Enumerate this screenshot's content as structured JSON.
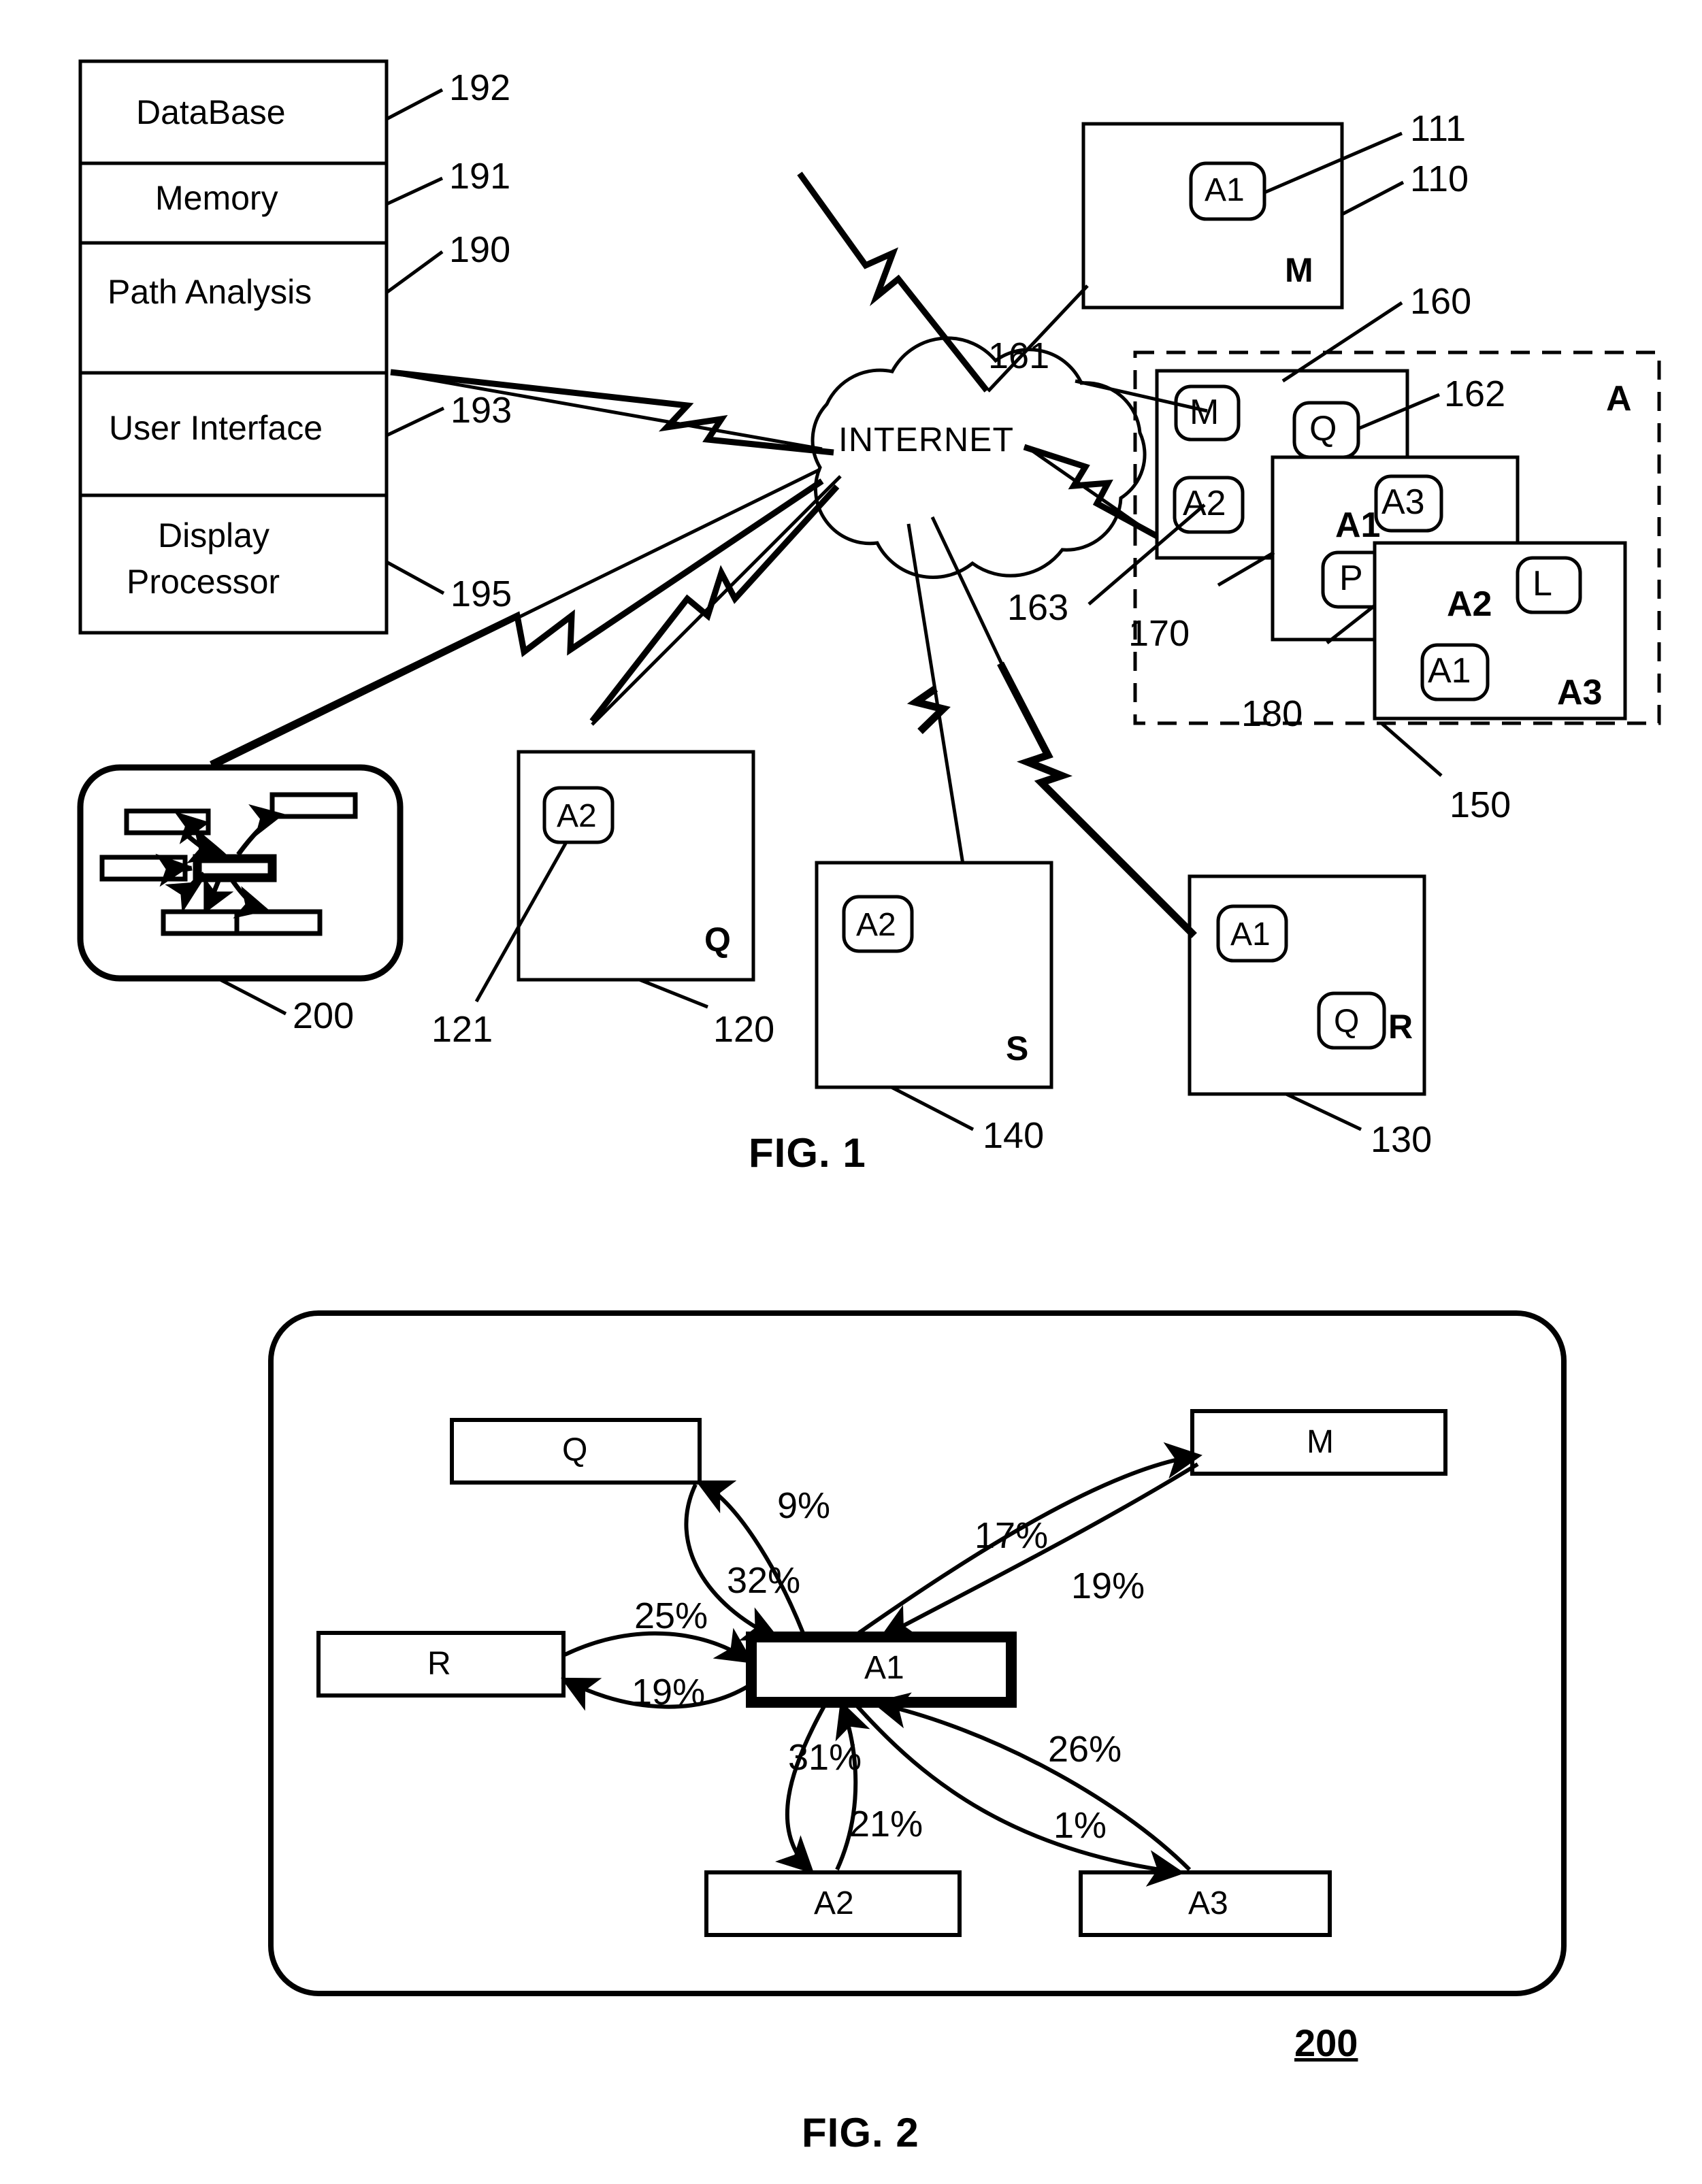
{
  "figure1": {
    "caption": "FIG. 1",
    "system_stack": {
      "rows": [
        {
          "label": "DataBase",
          "ref": "192"
        },
        {
          "label": "Memory",
          "ref": "191"
        },
        {
          "label": "Path Analysis",
          "ref": "190"
        },
        {
          "label": "User Interface",
          "ref": "193"
        },
        {
          "label": "Display Processor",
          "ref": "195"
        }
      ]
    },
    "network": {
      "label": "INTERNET",
      "icon": "cloud-icon"
    },
    "display_node": {
      "ref": "200"
    },
    "sites": [
      {
        "name": "site-110",
        "site_label": "M",
        "ref": "110",
        "ad_ref": "111",
        "ads": [
          "A1"
        ]
      },
      {
        "name": "site-120",
        "site_label": "Q",
        "ref": "120",
        "ad_ref": "121",
        "ads": [
          "A2"
        ]
      },
      {
        "name": "site-140",
        "site_label": "S",
        "ref": "140",
        "ads": [
          "A2"
        ]
      },
      {
        "name": "site-130",
        "site_label": "R",
        "ref": "130",
        "ads": [
          "A1",
          "Q"
        ]
      }
    ],
    "advertiser_group": {
      "ref": "150",
      "group_label": "A",
      "tiles": [
        {
          "name": "tile-160",
          "site_label": "A1",
          "ref": "160",
          "items": [
            "M",
            "Q",
            "A2"
          ],
          "item_refs": {
            "M": "161",
            "Q": "162",
            "A2": "163"
          }
        },
        {
          "name": "tile-170",
          "site_label": "A2",
          "ref": "170",
          "items": [
            "A3",
            "P"
          ]
        },
        {
          "name": "tile-180",
          "site_label": "A3",
          "ref": "180",
          "items": [
            "L",
            "A1"
          ]
        }
      ]
    }
  },
  "figure2": {
    "caption": "FIG. 2",
    "ref": "200",
    "chart_data": {
      "type": "diagram",
      "title": "FIG. 2",
      "center_node": "A1",
      "nodes": [
        "Q",
        "M",
        "R",
        "A1",
        "A2",
        "A3"
      ],
      "edges": [
        {
          "from": "A1",
          "to": "Q",
          "value": 9,
          "label": "9%"
        },
        {
          "from": "Q",
          "to": "A1",
          "value": 32,
          "label": "32%"
        },
        {
          "from": "A1",
          "to": "M",
          "value": 17,
          "label": "17%"
        },
        {
          "from": "M",
          "to": "A1",
          "value": 19,
          "label": "19%"
        },
        {
          "from": "R",
          "to": "A1",
          "value": 25,
          "label": "25%"
        },
        {
          "from": "A1",
          "to": "R",
          "value": 19,
          "label": "19%"
        },
        {
          "from": "A1",
          "to": "A2",
          "value": 31,
          "label": "31%"
        },
        {
          "from": "A2",
          "to": "A1",
          "value": 21,
          "label": "21%"
        },
        {
          "from": "A3",
          "to": "A1",
          "value": 26,
          "label": "26%"
        },
        {
          "from": "A1",
          "to": "A3",
          "value": 1,
          "label": "1%"
        }
      ]
    }
  }
}
